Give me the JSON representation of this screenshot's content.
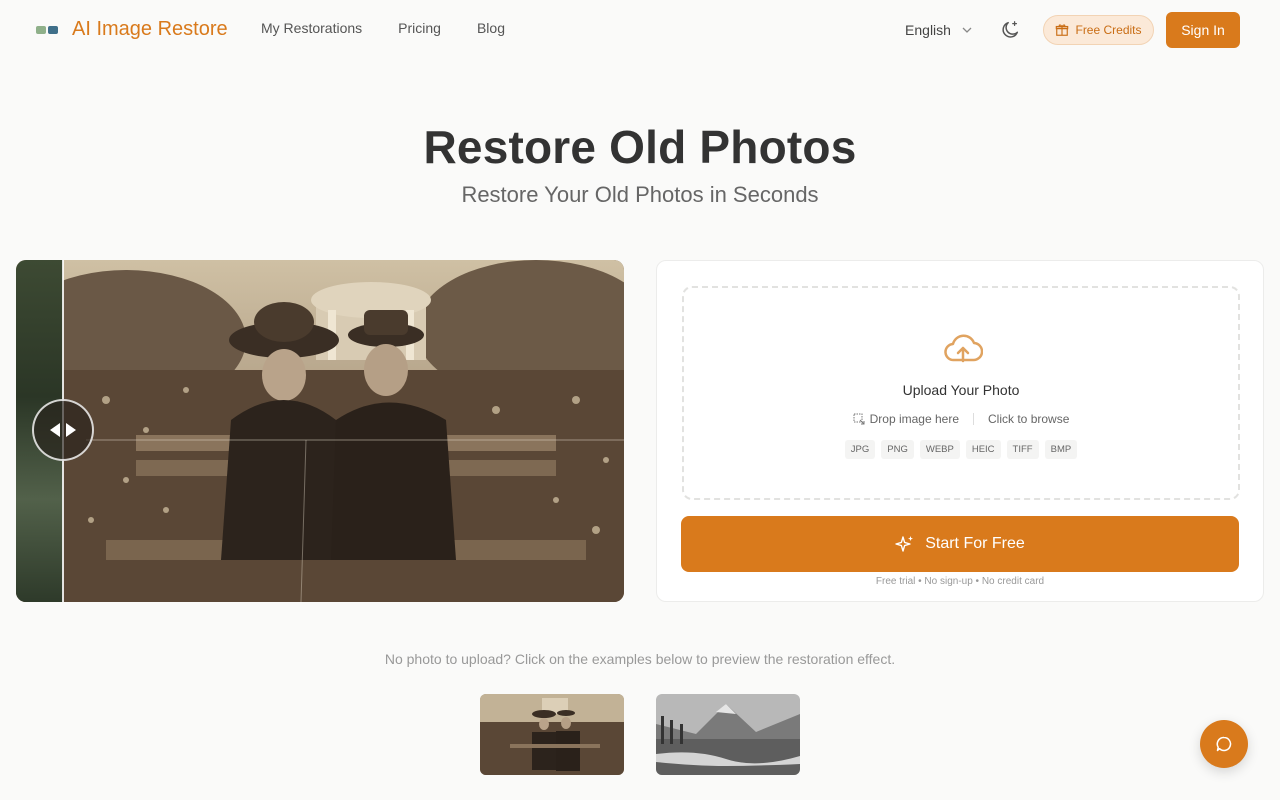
{
  "header": {
    "logo_text": "AI Image Restore",
    "nav": [
      "My Restorations",
      "Pricing",
      "Blog"
    ],
    "language": "English",
    "free_credits_label": "Free Credits",
    "sign_in_label": "Sign In"
  },
  "hero": {
    "title": "Restore Old Photos",
    "subtitle": "Restore Your Old Photos in Seconds"
  },
  "compare": {
    "slider_position_fraction": 0.077
  },
  "upload": {
    "title": "Upload Your Photo",
    "drop_label": "Drop image here",
    "browse_label": "Click to browse",
    "formats": [
      "JPG",
      "PNG",
      "WEBP",
      "HEIC",
      "TIFF",
      "BMP"
    ],
    "start_label": "Start For Free",
    "note": "Free trial • No sign-up • No credit card"
  },
  "examples": {
    "hint": "No photo to upload? Click on the examples below to preview the restoration effect."
  },
  "colors": {
    "accent": "#d97a1c",
    "accent_soft": "#fbe9d8"
  },
  "icons": {
    "theme": "moon-sparkle-icon",
    "gift": "gift-icon",
    "upload": "cloud-upload-icon",
    "drop": "image-drop-icon",
    "start": "sparkles-icon",
    "chat": "chat-bubble-icon",
    "slider": "slider-arrows-icon"
  }
}
